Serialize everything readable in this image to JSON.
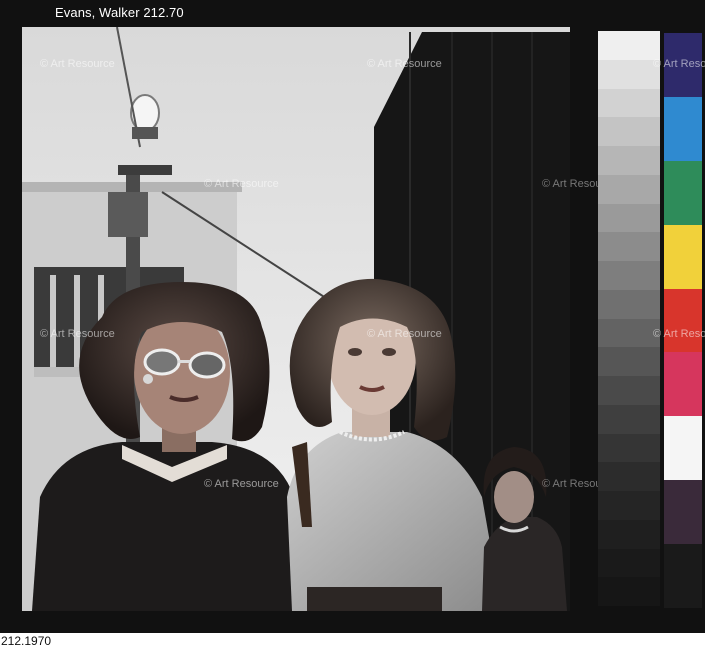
{
  "caption_top": "Evans, Walker 212.70",
  "caption_bottom": "212.1970",
  "watermark": "© Art Resource",
  "gray_scale": [
    "#efefef",
    "#e0e0e0",
    "#d2d2d2",
    "#c4c4c4",
    "#b6b6b6",
    "#a8a8a8",
    "#9a9a9a",
    "#8c8c8c",
    "#7e7e7e",
    "#707070",
    "#636363",
    "#565656",
    "#4a4a4a",
    "#3f3f3f",
    "#353535",
    "#2c2c2c",
    "#252525",
    "#1f1f1f",
    "#1a1a1a",
    "#161616"
  ],
  "color_patches": [
    "#2e2a6b",
    "#2f8ad0",
    "#2e8c5a",
    "#f1d13a",
    "#d8352c",
    "#d6365d",
    "#f5f5f5",
    "#3a2a3a",
    "#1a1a1a"
  ]
}
